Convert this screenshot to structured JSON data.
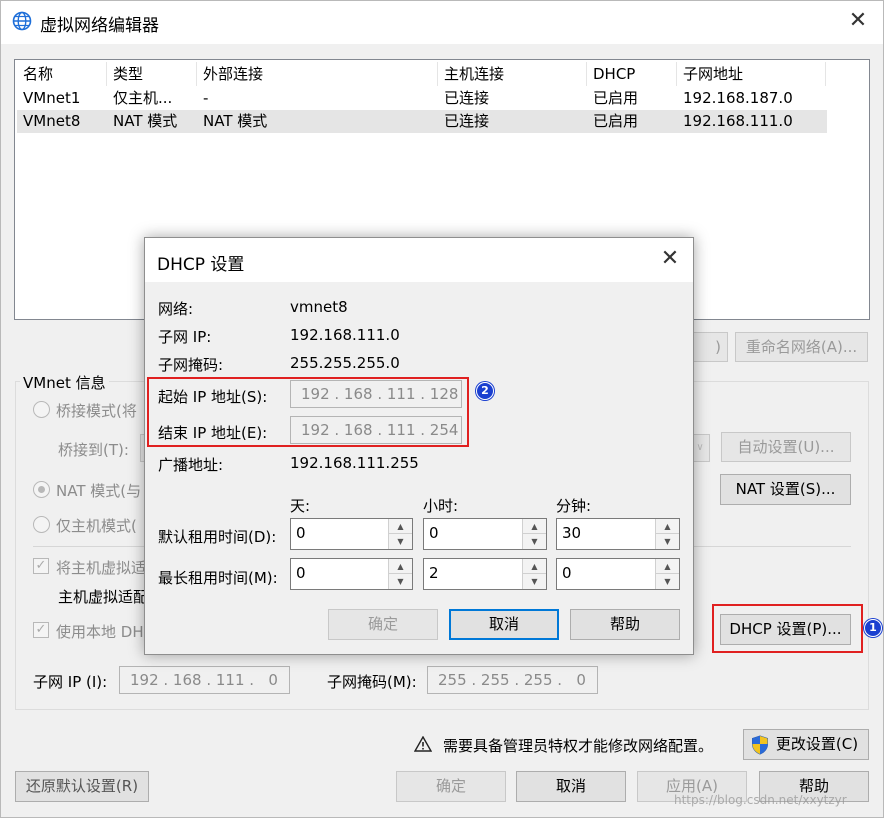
{
  "window": {
    "title": "虚拟网络编辑器",
    "icon": "globe-icon"
  },
  "network_list": {
    "columns": [
      "名称",
      "类型",
      "外部连接",
      "主机连接",
      "DHCP",
      "子网地址"
    ],
    "rows": [
      [
        "VMnet1",
        "仅主机...",
        "-",
        "已连接",
        "已启用",
        "192.168.187.0"
      ],
      [
        "VMnet8",
        "NAT 模式",
        "NAT 模式",
        "已连接",
        "已启用",
        "192.168.111.0"
      ]
    ],
    "selected_row": 1
  },
  "buttons_row": {
    "hidden_partial": ")",
    "rename": "重命名网络(A)..."
  },
  "vmnet_info": {
    "group_label": "VMnet 信息",
    "bridge_mode": "桥接模式(将",
    "bridge_to_label": "桥接到(T):",
    "auto_settings": "自动设置(U)...",
    "nat_mode": "NAT 模式(与",
    "nat_settings": "NAT 设置(S)...",
    "host_only": "仅主机模式(",
    "connect_adapter": "将主机虚拟适",
    "adapter_name": "主机虚拟适配",
    "use_dhcp": "使用本地 DH",
    "dhcp_settings": "DHCP 设置(P)...",
    "subnet_ip_label": "子网 IP (I):",
    "subnet_ip_value": "192 . 168 . 111 .   0",
    "subnet_mask_label": "子网掩码(M):",
    "subnet_mask_value": "255 . 255 . 255 .   0"
  },
  "footer": {
    "admin_notice": "需要具备管理员特权才能修改网络配置。",
    "change_settings": "更改设置(C)",
    "restore_defaults": "还原默认设置(R)",
    "ok": "确定",
    "cancel": "取消",
    "apply": "应用(A)",
    "help": "帮助",
    "watermark": "https://blog.csdn.net/xxytzyr"
  },
  "dhcp_dialog": {
    "title": "DHCP 设置",
    "network_label": "网络:",
    "network_value": "vmnet8",
    "subnet_ip_label": "子网 IP:",
    "subnet_ip_value": "192.168.111.0",
    "subnet_mask_label": "子网掩码:",
    "subnet_mask_value": "255.255.255.0",
    "start_ip_label": "起始 IP 地址(S):",
    "start_ip_value": "192 . 168 . 111 . 128",
    "end_ip_label": "结束 IP 地址(E):",
    "end_ip_value": "192 . 168 . 111 . 254",
    "broadcast_label": "广播地址:",
    "broadcast_value": "192.168.111.255",
    "col_days": "天:",
    "col_hours": "小时:",
    "col_minutes": "分钟:",
    "default_lease_label": "默认租用时间(D):",
    "default_lease": [
      "0",
      "0",
      "30"
    ],
    "max_lease_label": "最长租用时间(M):",
    "max_lease": [
      "0",
      "2",
      "0"
    ],
    "ok": "确定",
    "cancel": "取消",
    "help": "帮助"
  },
  "annotations": {
    "badge1": "1",
    "badge2": "2",
    "highlight_color": "#e02020",
    "badge_color": "#1a3fd0"
  }
}
